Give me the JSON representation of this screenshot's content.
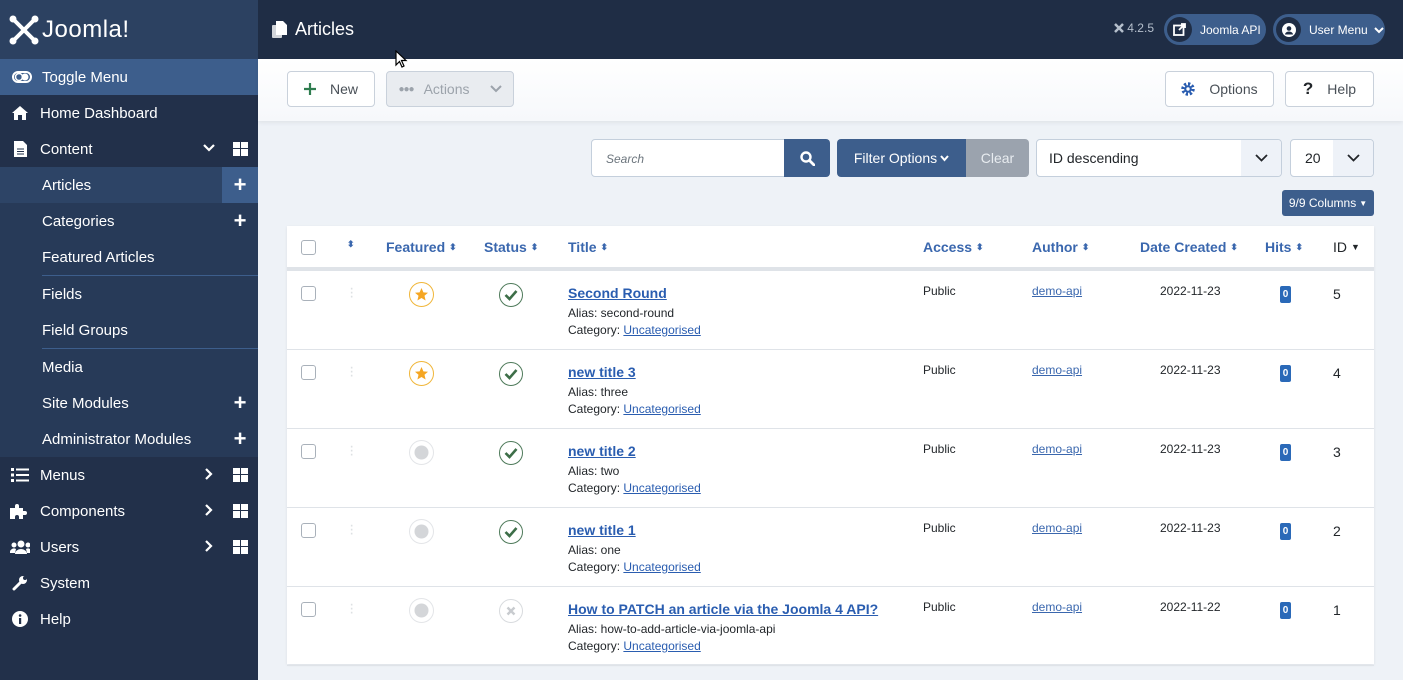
{
  "brand": {
    "name": "Joomla!"
  },
  "sidebar": {
    "toggle": "Toggle Menu",
    "home": "Home Dashboard",
    "content": "Content",
    "content_items": [
      {
        "label": "Articles",
        "add": true,
        "active": true
      },
      {
        "label": "Categories",
        "add": true,
        "active": false
      },
      {
        "label": "Featured Articles",
        "add": false,
        "active": false
      },
      {
        "label": "Fields",
        "add": false,
        "active": false
      },
      {
        "label": "Field Groups",
        "add": false,
        "active": false
      },
      {
        "label": "Media",
        "add": false,
        "active": false
      },
      {
        "label": "Site Modules",
        "add": true,
        "active": false
      },
      {
        "label": "Administrator Modules",
        "add": true,
        "active": false
      }
    ],
    "menus": "Menus",
    "components": "Components",
    "users": "Users",
    "system": "System",
    "help": "Help"
  },
  "header": {
    "title": "Articles",
    "version": "4.2.5",
    "api_label": "Joomla API",
    "user_menu": "User Menu"
  },
  "toolbar": {
    "new": "New",
    "actions": "Actions",
    "options": "Options",
    "help": "Help"
  },
  "filters": {
    "search_placeholder": "Search",
    "filter_options": "Filter Options",
    "clear": "Clear",
    "ordering": "ID descending",
    "limit": "20",
    "columns": "9/9 Columns"
  },
  "table": {
    "headers": {
      "featured": "Featured",
      "status": "Status",
      "title": "Title",
      "access": "Access",
      "author": "Author",
      "date": "Date Created",
      "hits": "Hits",
      "id": "ID"
    },
    "rows": [
      {
        "title": "Second Round",
        "alias": "Alias: second-round",
        "category_label": "Category:",
        "category": "Uncategorised",
        "featured": true,
        "published": true,
        "access": "Public",
        "author": "demo-api",
        "date": "2022-11-23",
        "hits": "0",
        "id": "5"
      },
      {
        "title": "new title 3",
        "alias": "Alias: three",
        "category_label": "Category:",
        "category": "Uncategorised",
        "featured": true,
        "published": true,
        "access": "Public",
        "author": "demo-api",
        "date": "2022-11-23",
        "hits": "0",
        "id": "4"
      },
      {
        "title": "new title 2",
        "alias": "Alias: two",
        "category_label": "Category:",
        "category": "Uncategorised",
        "featured": false,
        "published": true,
        "access": "Public",
        "author": "demo-api",
        "date": "2022-11-23",
        "hits": "0",
        "id": "3"
      },
      {
        "title": "new title 1",
        "alias": "Alias: one",
        "category_label": "Category:",
        "category": "Uncategorised",
        "featured": false,
        "published": true,
        "access": "Public",
        "author": "demo-api",
        "date": "2022-11-23",
        "hits": "0",
        "id": "2"
      },
      {
        "title": "How to PATCH an article via the Joomla 4 API?",
        "alias": "Alias: how-to-add-article-via-joomla-api",
        "category_label": "Category:",
        "category": "Uncategorised",
        "featured": false,
        "published": false,
        "access": "Public",
        "author": "demo-api",
        "date": "2022-11-22",
        "hits": "0",
        "id": "1"
      }
    ]
  }
}
